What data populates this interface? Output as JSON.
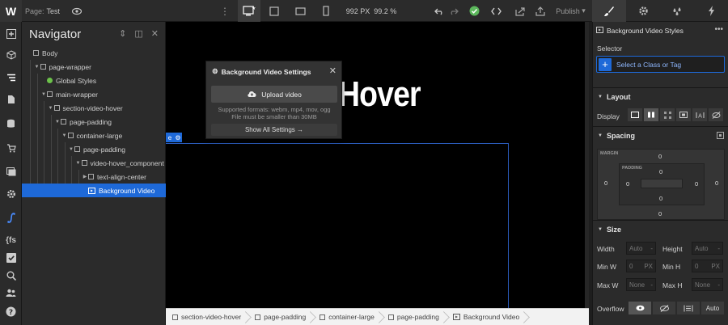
{
  "topbar": {
    "logo": "W",
    "page_label": "Page:",
    "page_name": "Test",
    "viewport_width": "992 PX",
    "zoom": "99.2 %",
    "publish_label": "Publish"
  },
  "navigator": {
    "title": "Navigator",
    "tree": [
      {
        "label": "Body",
        "depth": 0,
        "caret": "",
        "icon": "box",
        "selected": false
      },
      {
        "label": "page-wrapper",
        "depth": 1,
        "caret": "▼",
        "icon": "box",
        "selected": false
      },
      {
        "label": "Global Styles",
        "depth": 2,
        "caret": "",
        "icon": "dot",
        "selected": false
      },
      {
        "label": "main-wrapper",
        "depth": 2,
        "caret": "▼",
        "icon": "box",
        "selected": false
      },
      {
        "label": "section-video-hover",
        "depth": 3,
        "caret": "▼",
        "icon": "box",
        "selected": false
      },
      {
        "label": "page-padding",
        "depth": 4,
        "caret": "▼",
        "icon": "box",
        "selected": false
      },
      {
        "label": "container-large",
        "depth": 5,
        "caret": "▼",
        "icon": "box",
        "selected": false
      },
      {
        "label": "page-padding",
        "depth": 6,
        "caret": "▼",
        "icon": "box",
        "selected": false
      },
      {
        "label": "video-hover_component",
        "depth": 7,
        "caret": "▼",
        "icon": "box",
        "selected": false
      },
      {
        "label": "text-align-center",
        "depth": 8,
        "caret": "▶",
        "icon": "box",
        "selected": false
      },
      {
        "label": "Background Video",
        "depth": 8,
        "caret": "",
        "icon": "video",
        "selected": true
      }
    ]
  },
  "canvas": {
    "heading_fragment": "Hover"
  },
  "popup": {
    "title": "Background Video Settings",
    "upload_label": "Upload video",
    "formats_line1": "Supported formats: webm, mp4, mov, ogg",
    "formats_line2": "File must be smaller than 30MB",
    "show_all_label": "Show All Settings →"
  },
  "breadcrumb": [
    {
      "label": "section-video-hover",
      "icon": "box"
    },
    {
      "label": "page-padding",
      "icon": "box"
    },
    {
      "label": "container-large",
      "icon": "box"
    },
    {
      "label": "page-padding",
      "icon": "box"
    },
    {
      "label": "Background Video",
      "icon": "video"
    }
  ],
  "rightpanel": {
    "element_title": "Background Video Styles",
    "selector_label": "Selector",
    "selector_placeholder": "Select a Class or Tag",
    "layout_title": "Layout",
    "display_label": "Display",
    "spacing_title": "Spacing",
    "margin_label": "MARGIN",
    "padding_label": "PADDING",
    "margin": {
      "top": "0",
      "right": "0",
      "bottom": "0",
      "left": "0"
    },
    "padding": {
      "top": "0",
      "right": "0",
      "bottom": "0",
      "left": "0"
    },
    "size_title": "Size",
    "width_label": "Width",
    "width_value": "Auto",
    "height_label": "Height",
    "height_value": "Auto",
    "minw_label": "Min W",
    "minw_value": "0",
    "minh_label": "Min H",
    "minh_value": "0",
    "unit_px": "PX",
    "maxw_label": "Max W",
    "maxw_value": "None",
    "maxh_label": "Max H",
    "maxh_value": "None",
    "overflow_label": "Overflow",
    "overflow_auto": "Auto",
    "dash": "-"
  },
  "colors": {
    "accent": "#1e69d8",
    "success": "#5cb85c",
    "panel": "#2b2b2b"
  }
}
